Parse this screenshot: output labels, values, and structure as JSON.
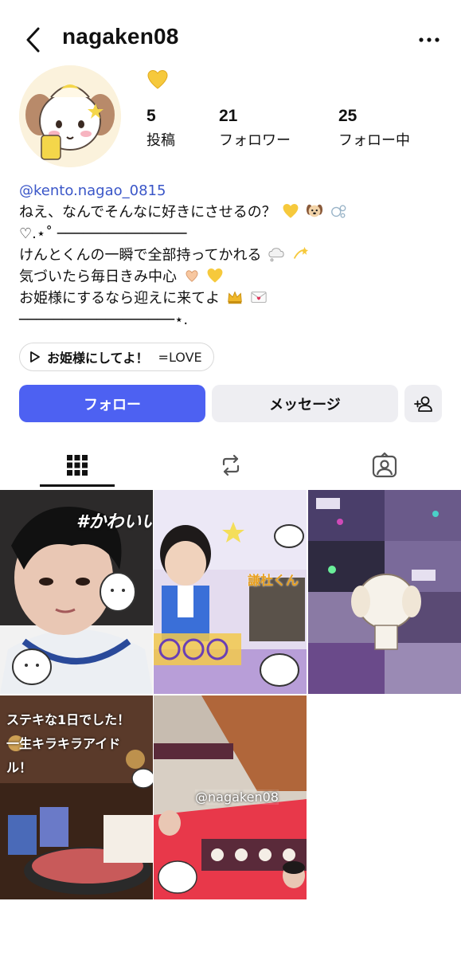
{
  "header": {
    "username": "nagaken08",
    "back_icon": "chevron-left-icon",
    "more_icon": "more-horizontal-icon"
  },
  "profile": {
    "note_emoji": "yellow-heart",
    "stats": [
      {
        "value": "5",
        "label": "投稿"
      },
      {
        "value": "21",
        "label": "フォロワー"
      },
      {
        "value": "25",
        "label": "フォロー中"
      }
    ]
  },
  "bio": {
    "handle": "@kento.nagao_0815",
    "line1": "ねえ、なんでそんなに好きにさせるの？",
    "line2": "♡.⋆˚ ───────────────",
    "line3": "けんとくんの一瞬で全部持ってかれる",
    "line4": "気づいたら毎日きみ中心",
    "line5": "お姫様にするなら迎えに来てよ",
    "line6": "──────────────────⋆."
  },
  "music": {
    "title": "お姫様にしてよ！",
    "artist": "=LOVE"
  },
  "actions": {
    "follow_label": "フォロー",
    "message_label": "メッセージ"
  },
  "tabs": [
    "grid-icon",
    "repost-icon",
    "tagged-icon"
  ],
  "posts": [
    {
      "overlay_text": "#かわいい"
    },
    {
      "overlay_text": "謙杜くん"
    },
    {
      "overlay_text": ""
    },
    {
      "overlay_text": "ステキな1日でした！ 一生キラキラアイドル！"
    },
    {
      "overlay_text": "@nagaken08"
    }
  ],
  "colors": {
    "accent": "#4d61f2",
    "link": "#3a56c8",
    "secondary_button": "#eeeef2"
  }
}
